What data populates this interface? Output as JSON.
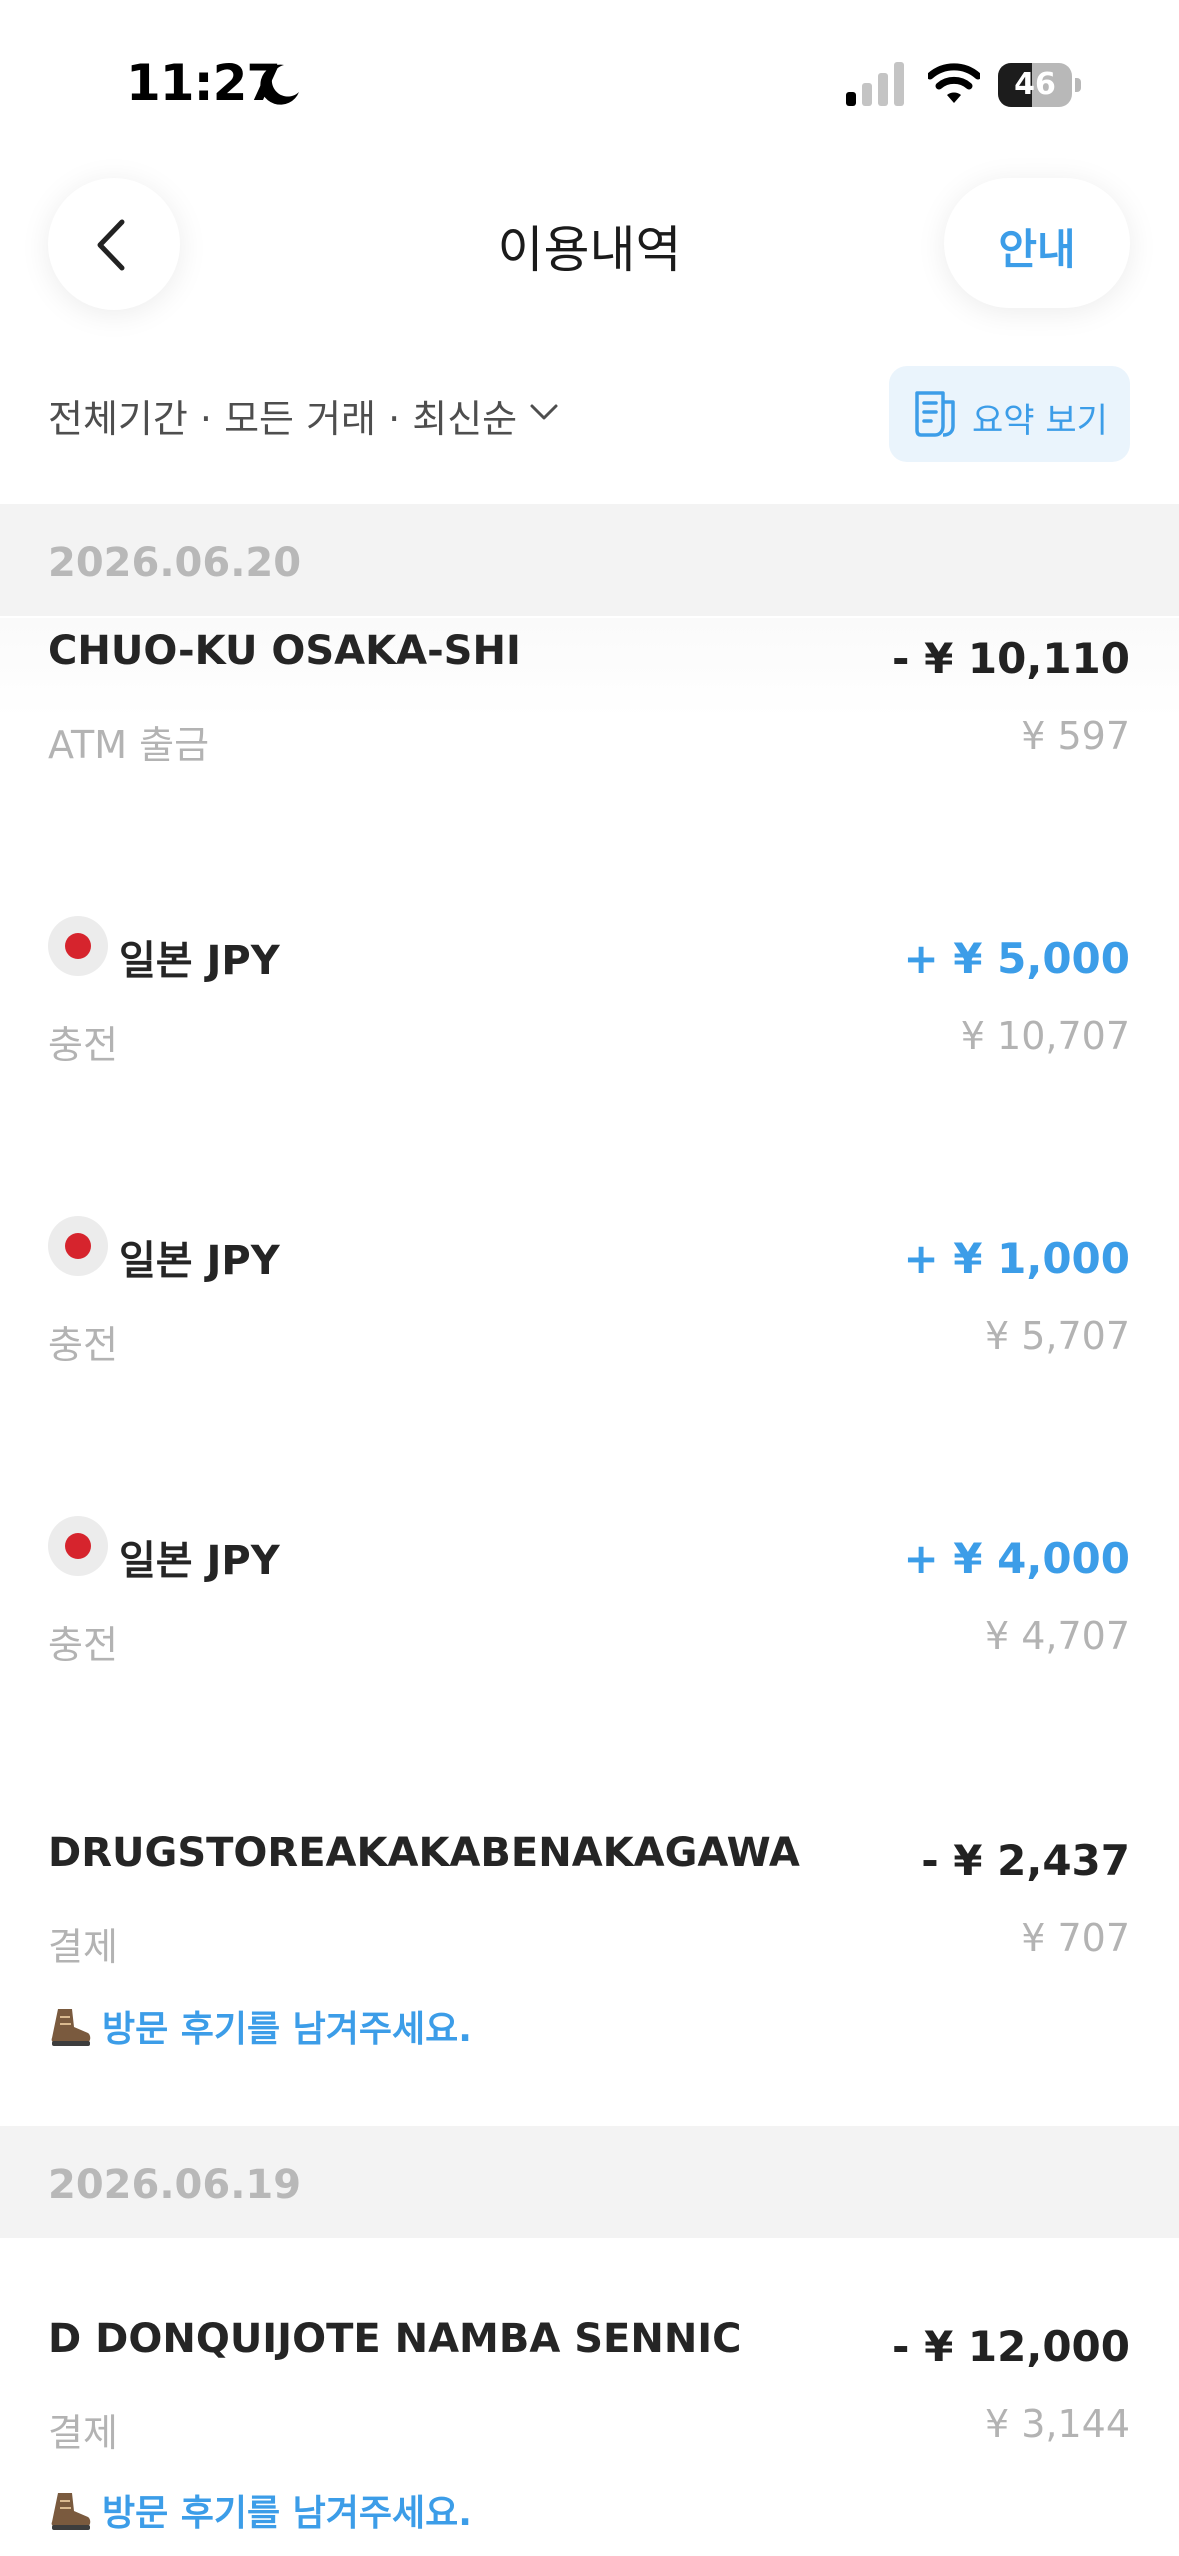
{
  "status_bar": {
    "time": "11:27",
    "battery": "46",
    "battery_level": 0.46
  },
  "header": {
    "title": "이용내역",
    "guide_label": "안내"
  },
  "filter": {
    "label": "전체기간 · 모든 거래 · 최신순",
    "summary_label": "요약 보기"
  },
  "sections": [
    {
      "date": "2026.06.20",
      "items": [
        {
          "name": "CHUO-KU OSAKA-SHI",
          "amount": "- ¥ 10,110",
          "type": "ATM 출금",
          "balance": "¥ 597"
        },
        {
          "name": "일본 JPY",
          "amount": "+ ¥ 5,000",
          "type": "충전",
          "balance": "¥ 10,707"
        },
        {
          "name": "일본 JPY",
          "amount": "+ ¥ 1,000",
          "type": "충전",
          "balance": "¥ 5,707"
        },
        {
          "name": "일본 JPY",
          "amount": "+ ¥ 4,000",
          "type": "충전",
          "balance": "¥ 4,707"
        },
        {
          "name": "DRUGSTOREAKAKABENAKAGAWA",
          "amount": "- ¥ 2,437",
          "type": "결제",
          "balance": "¥ 707",
          "review": "방문 후기를 남겨주세요."
        }
      ]
    },
    {
      "date": "2026.06.19",
      "items": [
        {
          "name": "D DONQUIJOTE NAMBA SENNIC",
          "amount": "- ¥ 12,000",
          "type": "결제",
          "balance": "¥ 3,144",
          "review": "방문 후기를 남겨주세요."
        }
      ]
    }
  ],
  "colors": {
    "accent": "#3c9de8",
    "flag_red": "#d6242d",
    "muted": "#b3b3b3",
    "section_bg": "#f3f3f3"
  },
  "icons": [
    "moon-icon",
    "signal-icon",
    "wifi-icon",
    "battery-icon",
    "back-arrow-icon",
    "chevron-down-icon",
    "receipt-icon",
    "japan-flag-icon",
    "boot-icon"
  ]
}
